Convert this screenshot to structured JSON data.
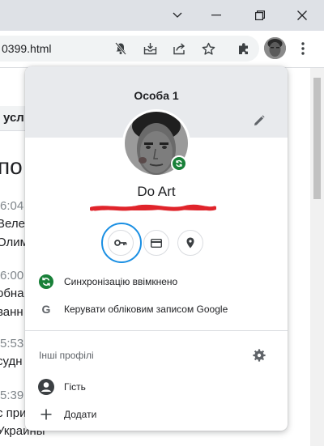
{
  "browser": {
    "url": "0399.html",
    "window_controls": [
      "chevron-down-icon",
      "minimize-icon",
      "restore-icon",
      "close-icon"
    ],
    "toolbar_icons": [
      "notifications-off-icon",
      "install-app-icon",
      "share-icon",
      "bookmark-star-icon",
      "extensions-icon",
      "profile-avatar-icon",
      "menu-icon"
    ]
  },
  "page_behind": {
    "tab_fragment": "усл",
    "heading_fragment": "по",
    "times": [
      "6:04",
      "6:00",
      "5:53",
      "5:39"
    ],
    "lines": [
      "Веле",
      "Олим",
      "обна",
      "ванн",
      "судн",
      "с при",
      "Украины"
    ]
  },
  "profile_menu": {
    "profile_title": "Особа 1",
    "user_name": "Do Art",
    "user_email": "",
    "quick_actions": [
      "key-icon",
      "credit-card-icon",
      "location-pin-icon"
    ],
    "sync_status": "Синхронізацію ввімкнено",
    "manage_account": "Керувати обліковим записом Google",
    "other_profiles_label": "Інші профілі",
    "guest_label": "Гість",
    "add_label": "Додати"
  },
  "colors": {
    "header_bg": "#e8eaed",
    "sync_green": "#188038",
    "highlight_ring": "#1a8fe3",
    "redaction_red": "#e0242b"
  }
}
